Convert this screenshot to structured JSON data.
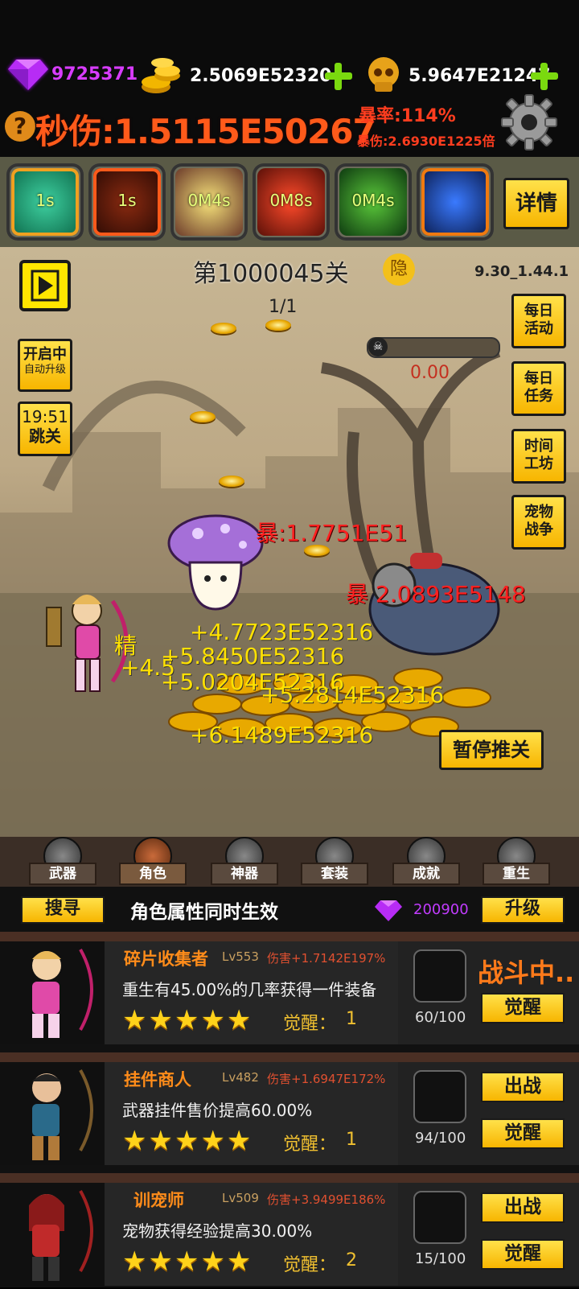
{
  "hud": {
    "gems": "9725371",
    "gold": "2.5069E52320",
    "skulls": "5.9647E21247",
    "dps": "秒伤:1.5115E50267",
    "crit_rate": "暴率:114%",
    "crit_dmg": "暴伤:2.6930E1225倍",
    "help_symbol": "?"
  },
  "skills": {
    "cooldowns": [
      "1s",
      "1s",
      "0M4s",
      "0M8s",
      "0M4s",
      ""
    ],
    "details_label": "详情"
  },
  "stage": {
    "title": "第1000045关",
    "hidden_label": "隐",
    "version": "9.30_1.44.1",
    "wave": "1/1",
    "boss_hp": "0.00",
    "auto_upgrade_status": "开启中",
    "auto_upgrade_label": "自动升级",
    "skip_timer": "19:51",
    "skip_label": "跳关",
    "pause_label": "暂停推关"
  },
  "side_menu": [
    {
      "label": "每日\n活动"
    },
    {
      "label": "每日\n任务"
    },
    {
      "label": "时间\n工坊"
    },
    {
      "label": "宠物\n战争"
    }
  ],
  "damage_numbers": {
    "yellow": [
      "+4.7723E52316",
      "+5.8450E52316",
      "+5.0204E52316",
      "+5.2814E52316",
      "+6.1489E52316",
      "+4.5",
      "精"
    ],
    "red": [
      "暴:1.7751E51",
      "暴 2.0893E5148"
    ]
  },
  "tabs": [
    {
      "label": "武器"
    },
    {
      "label": "角色"
    },
    {
      "label": "神器"
    },
    {
      "label": "套装"
    },
    {
      "label": "成就"
    },
    {
      "label": "重生"
    }
  ],
  "panel": {
    "search_label": "搜寻",
    "heading": "角色属性同时生效",
    "gem_cost": "200900",
    "upgrade_label": "升级"
  },
  "heroes": [
    {
      "name": "碎片收集者",
      "level": "Lv553",
      "damage": "伤害+1.7142E197%",
      "description": "重生有45.00%的几率获得一件装备",
      "stars": "★★★★★",
      "awaken_text": "觉醒：",
      "awaken_level": "1",
      "progress": "60/100",
      "status": "战斗中..",
      "action2": "觉醒"
    },
    {
      "name": "挂件商人",
      "level": "Lv482",
      "damage": "伤害+1.6947E172%",
      "description": "武器挂件售价提高60.00%",
      "stars": "★★★★★",
      "awaken_text": "觉醒：",
      "awaken_level": "1",
      "progress": "94/100",
      "action1": "出战",
      "action2": "觉醒"
    },
    {
      "name": "训宠师",
      "level": "Lv509",
      "damage": "伤害+3.9499E186%",
      "description": "宠物获得经验提高30.00%",
      "stars": "★★★★★",
      "awaken_text": "觉醒：",
      "awaken_level": "2",
      "progress": "15/100",
      "action1": "出战",
      "action2": "觉醒"
    }
  ],
  "colors": {
    "accent_yellow": "#f7c400",
    "dps_orange": "#ff5a1a",
    "gem_purple": "#c23cff",
    "plus_green": "#7ad90f"
  }
}
